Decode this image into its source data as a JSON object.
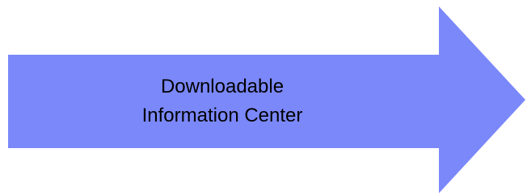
{
  "arrow": {
    "fill_color": "#7b88fa",
    "line1": "Downloadable",
    "line2": "Information Center"
  }
}
